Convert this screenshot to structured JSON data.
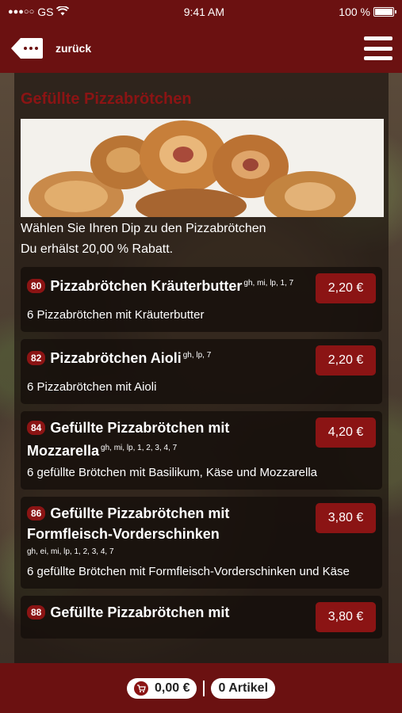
{
  "status_bar": {
    "signal": "●●●○○",
    "carrier": "GS",
    "time": "9:41 AM",
    "battery": "100 %"
  },
  "nav": {
    "back_label": "zurück"
  },
  "category": {
    "title": "Gefüllte Pizzabrötchen",
    "intro_line1": "Wählen Sie Ihren Dip zu den Pizzabrötchen",
    "intro_line2": "Du erhälst 20,00 % Rabatt."
  },
  "items": [
    {
      "number": "80",
      "name": "Pizzabrötchen Kräuterbutter",
      "allergens": "gh, mi, lp, 1, 7",
      "description": "6 Pizzabrötchen mit Kräuterbutter",
      "price": "2,20 €"
    },
    {
      "number": "82",
      "name": "Pizzabrötchen Aioli",
      "allergens": "gh, lp, 7",
      "description": "6 Pizzabrötchen mit Aioli",
      "price": "2,20 €"
    },
    {
      "number": "84",
      "name": "Gefüllte Pizzabrötchen mit Mozzarella",
      "allergens": "gh, mi, lp, 1, 2, 3, 4, 7",
      "description": "6 gefüllte Brötchen mit Basilikum, Käse und Mozzarella",
      "price": "4,20 €"
    },
    {
      "number": "86",
      "name": "Gefüllte Pizzabrötchen mit Formfleisch-Vorderschinken",
      "allergens": "gh, ei, mi, lp, 1, 2, 3, 4, 7",
      "description": "6 gefüllte Brötchen mit Formfleisch-Vorderschinken und Käse",
      "price": "3,80 €"
    },
    {
      "number": "88",
      "name": "Gefüllte Pizzabrötchen mit",
      "allergens": "",
      "description": "",
      "price": "3,80 €"
    }
  ],
  "cart": {
    "total": "0,00 €",
    "count_label": "0 Artikel"
  },
  "colors": {
    "brand": "#6b1111",
    "accent": "#8b1414"
  },
  "icons": {
    "back": "back-arrow-icon",
    "menu": "hamburger-menu-icon",
    "cart": "cart-icon",
    "wifi": "wifi-icon",
    "battery": "battery-icon"
  }
}
